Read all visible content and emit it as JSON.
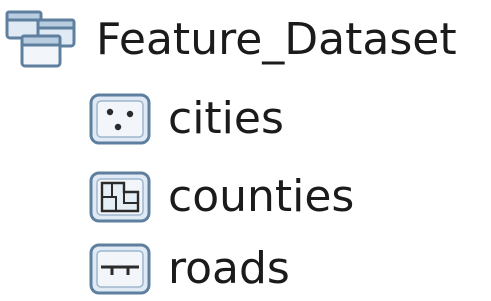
{
  "tree": {
    "dataset": {
      "label": "Feature_Dataset",
      "icon": "feature-dataset-icon"
    },
    "children": [
      {
        "label": "cities",
        "icon": "point-feature-class-icon"
      },
      {
        "label": "counties",
        "icon": "polygon-feature-class-icon"
      },
      {
        "label": "roads",
        "icon": "line-feature-class-icon"
      }
    ]
  },
  "colors": {
    "icon_border": "#5f7f9f",
    "icon_fill": "#dfeaf4",
    "icon_fill_inner": "#f2f6fa",
    "glyph": "#2b2b2b",
    "text": "#1b1b1b",
    "background": "#ffffff"
  }
}
